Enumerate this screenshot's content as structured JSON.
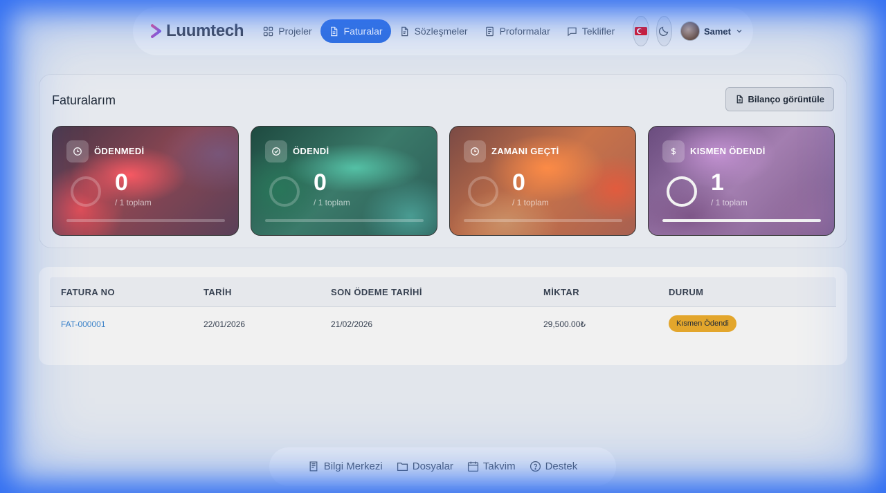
{
  "brand": {
    "name": "Luumtech"
  },
  "nav": {
    "items": [
      {
        "label": "Projeler",
        "icon": "grid-icon",
        "active": false
      },
      {
        "label": "Faturalar",
        "icon": "file-icon",
        "active": true
      },
      {
        "label": "Sözleşmeler",
        "icon": "file-text-icon",
        "active": false
      },
      {
        "label": "Proformalar",
        "icon": "receipt-icon",
        "active": false
      },
      {
        "label": "Teklifler",
        "icon": "message-icon",
        "active": false
      }
    ],
    "language_flag": "tr-flag-icon",
    "theme_icon": "moon-icon",
    "user": {
      "name": "Samet"
    }
  },
  "invoices_panel": {
    "title": "Faturalarım",
    "balance_button": "Bilanço görüntüle",
    "cards": [
      {
        "title": "ÖDENMEDİ",
        "icon": "clock-icon",
        "count": "0",
        "subtitle": "/ 1 toplam",
        "progress": 0
      },
      {
        "title": "ÖDENDİ",
        "icon": "check-circle-icon",
        "count": "0",
        "subtitle": "/ 1 toplam",
        "progress": 0
      },
      {
        "title": "ZAMANI GEÇTİ",
        "icon": "clock-icon",
        "count": "0",
        "subtitle": "/ 1 toplam",
        "progress": 0
      },
      {
        "title": "KISMEN ÖDENDİ",
        "icon": "dollar-icon",
        "count": "1",
        "subtitle": "/ 1 toplam",
        "progress": 1
      }
    ]
  },
  "table": {
    "columns": [
      "FATURA NO",
      "TARİH",
      "SON ÖDEME TARİHİ",
      "MİKTAR",
      "DURUM"
    ],
    "rows": [
      {
        "invoice_no": "FAT-000001",
        "date": "22/01/2026",
        "due_date": "21/02/2026",
        "amount": "29,500.00₺",
        "status": "Kısmen Ödendi"
      }
    ]
  },
  "bottom_nav": {
    "items": [
      {
        "label": "Bilgi Merkezi",
        "icon": "book-icon"
      },
      {
        "label": "Dosyalar",
        "icon": "folder-icon"
      },
      {
        "label": "Takvim",
        "icon": "calendar-icon"
      },
      {
        "label": "Destek",
        "icon": "help-circle-icon"
      }
    ]
  },
  "colors": {
    "accent": "#2f6fe0",
    "badge": "#e3a62c",
    "link": "#3b82c8"
  }
}
